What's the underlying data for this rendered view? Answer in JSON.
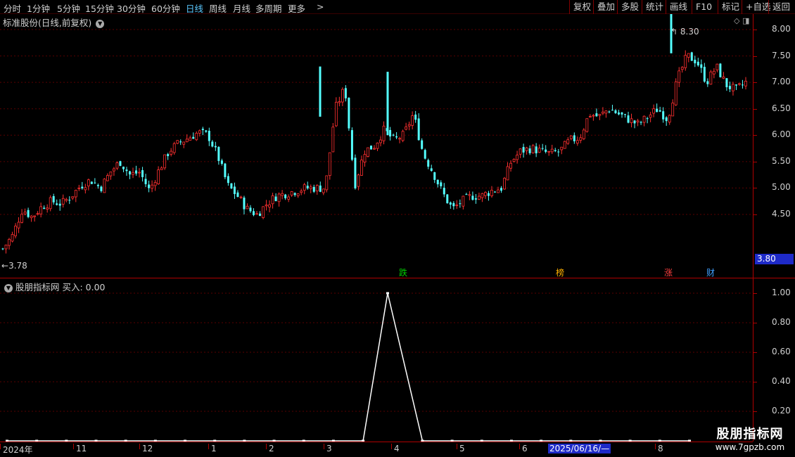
{
  "toolbar": {
    "timeframes": [
      "分时",
      "1分钟",
      "5分钟",
      "15分钟",
      "30分钟",
      "60分钟",
      "日线",
      "周线",
      "月线",
      "多周期",
      "更多"
    ],
    "active_timeframe": "日线",
    "more_arrow": ">",
    "right_buttons": [
      "复权",
      "叠加",
      "多股",
      "统计",
      "画线",
      "F10",
      "标记",
      "+自选",
      "返回"
    ]
  },
  "main": {
    "title": "标准股份(日线,前复权)",
    "high_label": "8.30",
    "low_label": "3.78",
    "last_price": "3.80",
    "markers": [
      {
        "text": "跌",
        "color": "#00d000"
      },
      {
        "text": "榜",
        "color": "#ffb000"
      },
      {
        "text": "涨",
        "color": "#ff4040"
      },
      {
        "text": "财",
        "color": "#40a0ff"
      }
    ]
  },
  "price_axis": {
    "ticks": [
      "8.00",
      "7.50",
      "7.00",
      "6.50",
      "6.00",
      "5.50",
      "5.00",
      "4.50"
    ]
  },
  "indicator": {
    "title": "股朋指标网",
    "value_label": "买入: 0.00",
    "ticks": [
      "1.00",
      "0.80",
      "0.60",
      "0.40",
      "0.20"
    ]
  },
  "date_axis": {
    "labels": [
      "2024年",
      "11",
      "12",
      "1",
      "2",
      "3",
      "4",
      "5",
      "6",
      "8"
    ],
    "cursor_date": "2025/06/16/—"
  },
  "watermark": {
    "title": "股朋指标网",
    "url": "www.7gpzb.com"
  },
  "colors": {
    "up": "#ff3030",
    "down": "#54ffff",
    "grid": "#5a0000",
    "axis": "#b00000",
    "active": "#5ac8ff"
  },
  "chart_data": [
    {
      "type": "candlestick",
      "title": "标准股份(日线,前复权)",
      "y_ticks": [
        4.5,
        5.0,
        5.5,
        6.0,
        6.5,
        7.0,
        7.5,
        8.0
      ],
      "ylim": [
        3.8,
        8.4
      ],
      "x_ticks": [
        "2024年",
        "11",
        "12",
        "1",
        "2",
        "3",
        "4",
        "5",
        "6",
        "8"
      ],
      "high": 8.3,
      "low": 3.78,
      "last": 3.8,
      "close_path": [
        3.85,
        4.1,
        4.6,
        4.45,
        4.65,
        4.75,
        4.7,
        4.85,
        5.05,
        5.15,
        5.0,
        5.3,
        5.5,
        5.25,
        5.3,
        4.95,
        5.35,
        5.7,
        5.85,
        5.95,
        6.05,
        6.0,
        5.6,
        5.05,
        4.85,
        4.6,
        4.5,
        4.7,
        4.85,
        4.9,
        4.95,
        5.0,
        5.0,
        5.0,
        6.5,
        6.9,
        5.05,
        5.7,
        5.8,
        6.1,
        5.9,
        6.0,
        6.4,
        5.65,
        5.3,
        4.9,
        4.6,
        4.75,
        4.85,
        4.85,
        4.95,
        5.0,
        5.5,
        5.7,
        5.75,
        5.7,
        5.65,
        5.7,
        5.9,
        5.95,
        6.4,
        6.35,
        6.5,
        6.4,
        6.3,
        6.2,
        6.35,
        6.5,
        6.3,
        7.05,
        7.5,
        7.4,
        7.0,
        7.3,
        6.95,
        6.85,
        7.0
      ]
    },
    {
      "type": "line",
      "title": "股朋指标网",
      "series": [
        {
          "name": "买入",
          "values": [
            0,
            0,
            0,
            0,
            0,
            0,
            0,
            0,
            0,
            0,
            0,
            0,
            0,
            1,
            0,
            0,
            0,
            0,
            0,
            0,
            0,
            0,
            0,
            0
          ]
        }
      ],
      "y_ticks": [
        0.2,
        0.4,
        0.6,
        0.8,
        1.0
      ],
      "ylim": [
        0,
        1.05
      ]
    }
  ]
}
